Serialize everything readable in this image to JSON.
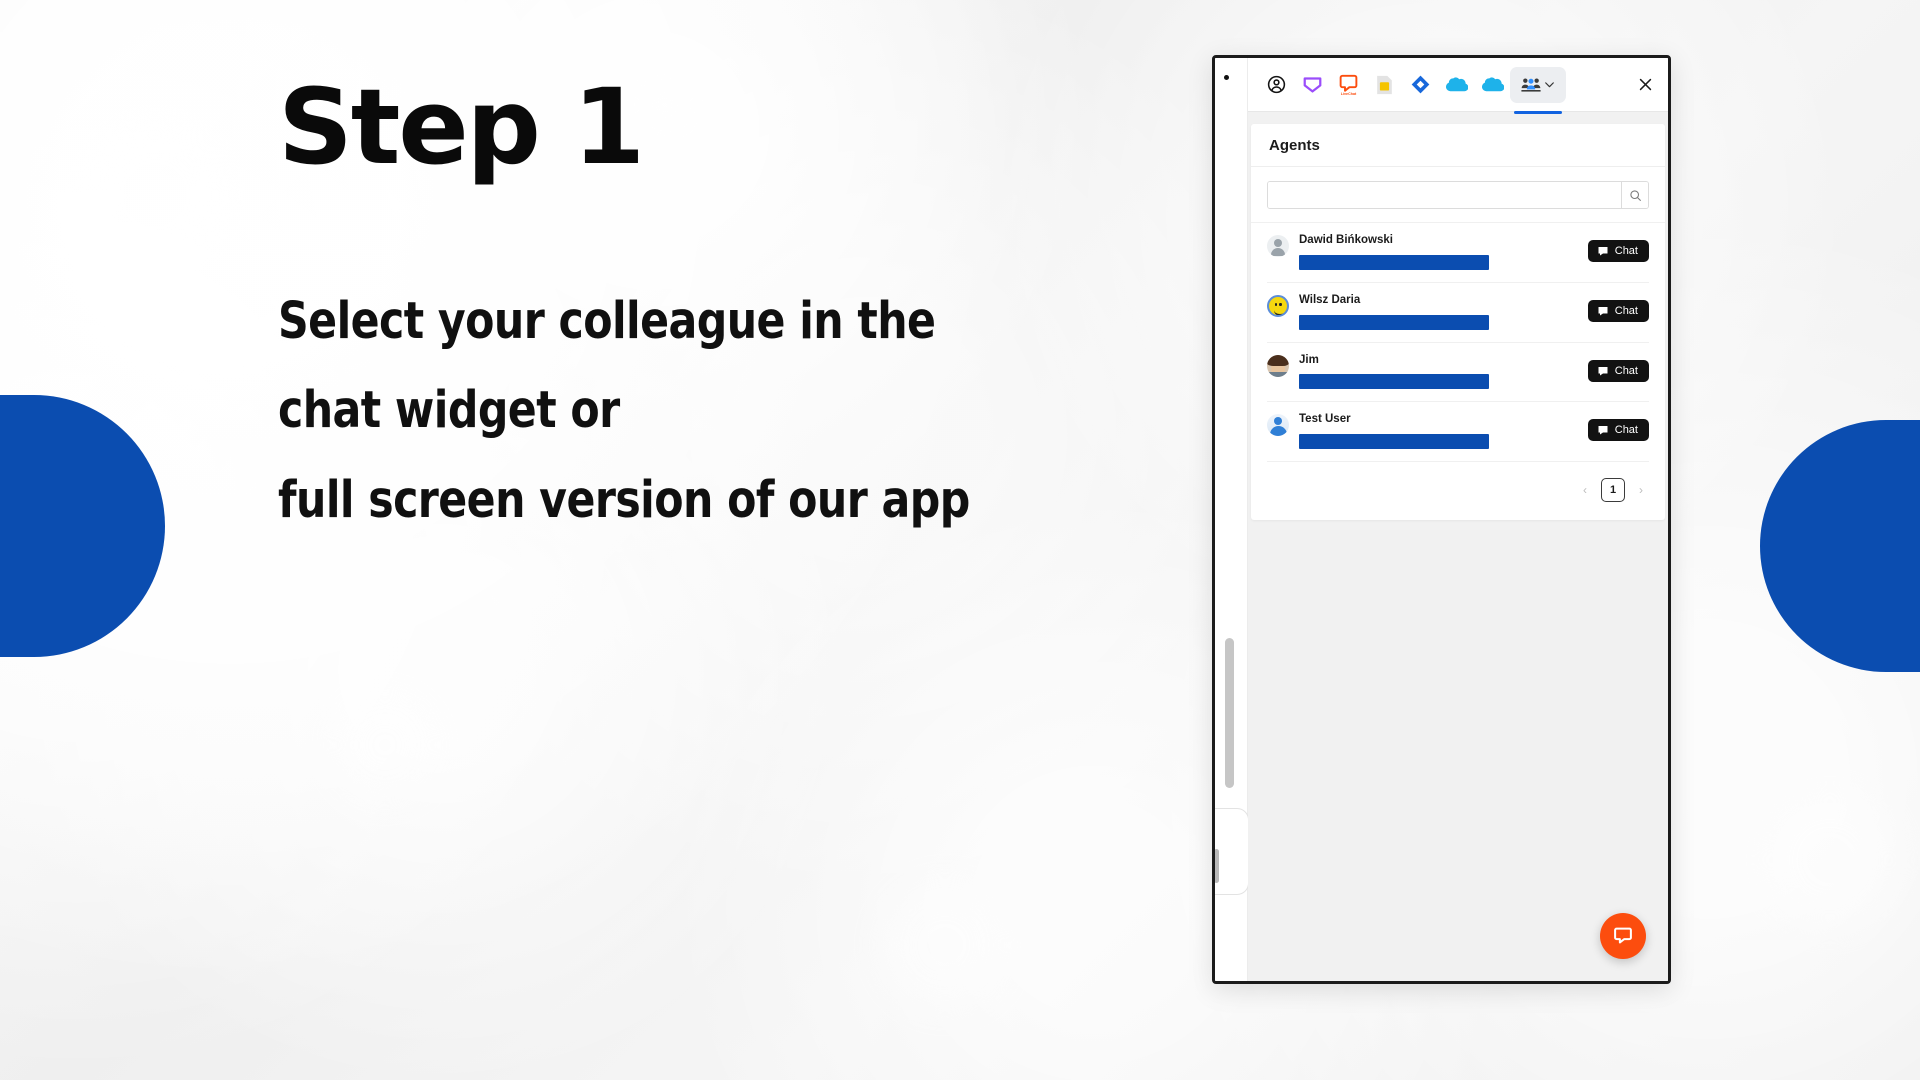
{
  "slide": {
    "title": "Step 1",
    "lines": [
      "Select your colleague in the",
      "chat widget or",
      "full screen version of our app"
    ],
    "accent_color": "#0b4db0"
  },
  "window": {
    "rail": {
      "menu_dot": "•"
    },
    "toolbar": {
      "items": [
        {
          "name": "account-icon",
          "label": "Account"
        },
        {
          "name": "inbox-icon",
          "label": "Inbox"
        },
        {
          "name": "livechat-icon",
          "label": "LiveChat"
        },
        {
          "name": "sim-card-icon",
          "label": "SIM"
        },
        {
          "name": "jira-icon",
          "label": "Jira"
        },
        {
          "name": "salesforce-icon",
          "label": "Salesforce"
        },
        {
          "name": "salesforce-alt-icon",
          "label": "Salesforce"
        }
      ],
      "active_tab": {
        "name": "agents-tab",
        "label": "Agents",
        "chevron": "⌄"
      },
      "close_label": "Close"
    },
    "card": {
      "heading": "Agents",
      "search": {
        "value": "",
        "placeholder": "",
        "button_label": "Search"
      },
      "agents": [
        {
          "name": "Dawid Bińkowski",
          "avatar": "default-person-avatar",
          "detail_redacted": true,
          "action": "Chat"
        },
        {
          "name": "Wilsz Daria",
          "avatar": "smiley-avatar",
          "detail_redacted": true,
          "action": "Chat"
        },
        {
          "name": "Jim",
          "avatar": "photo-avatar",
          "detail_redacted": true,
          "action": "Chat"
        },
        {
          "name": "Test User",
          "avatar": "blue-person-avatar",
          "detail_redacted": true,
          "action": "Chat"
        }
      ],
      "pagination": {
        "prev": "‹",
        "current": "1",
        "next": "›"
      }
    },
    "fab": {
      "name": "livechat-bubble-button",
      "label": "Open chat",
      "color": "#fc4d0e"
    }
  }
}
